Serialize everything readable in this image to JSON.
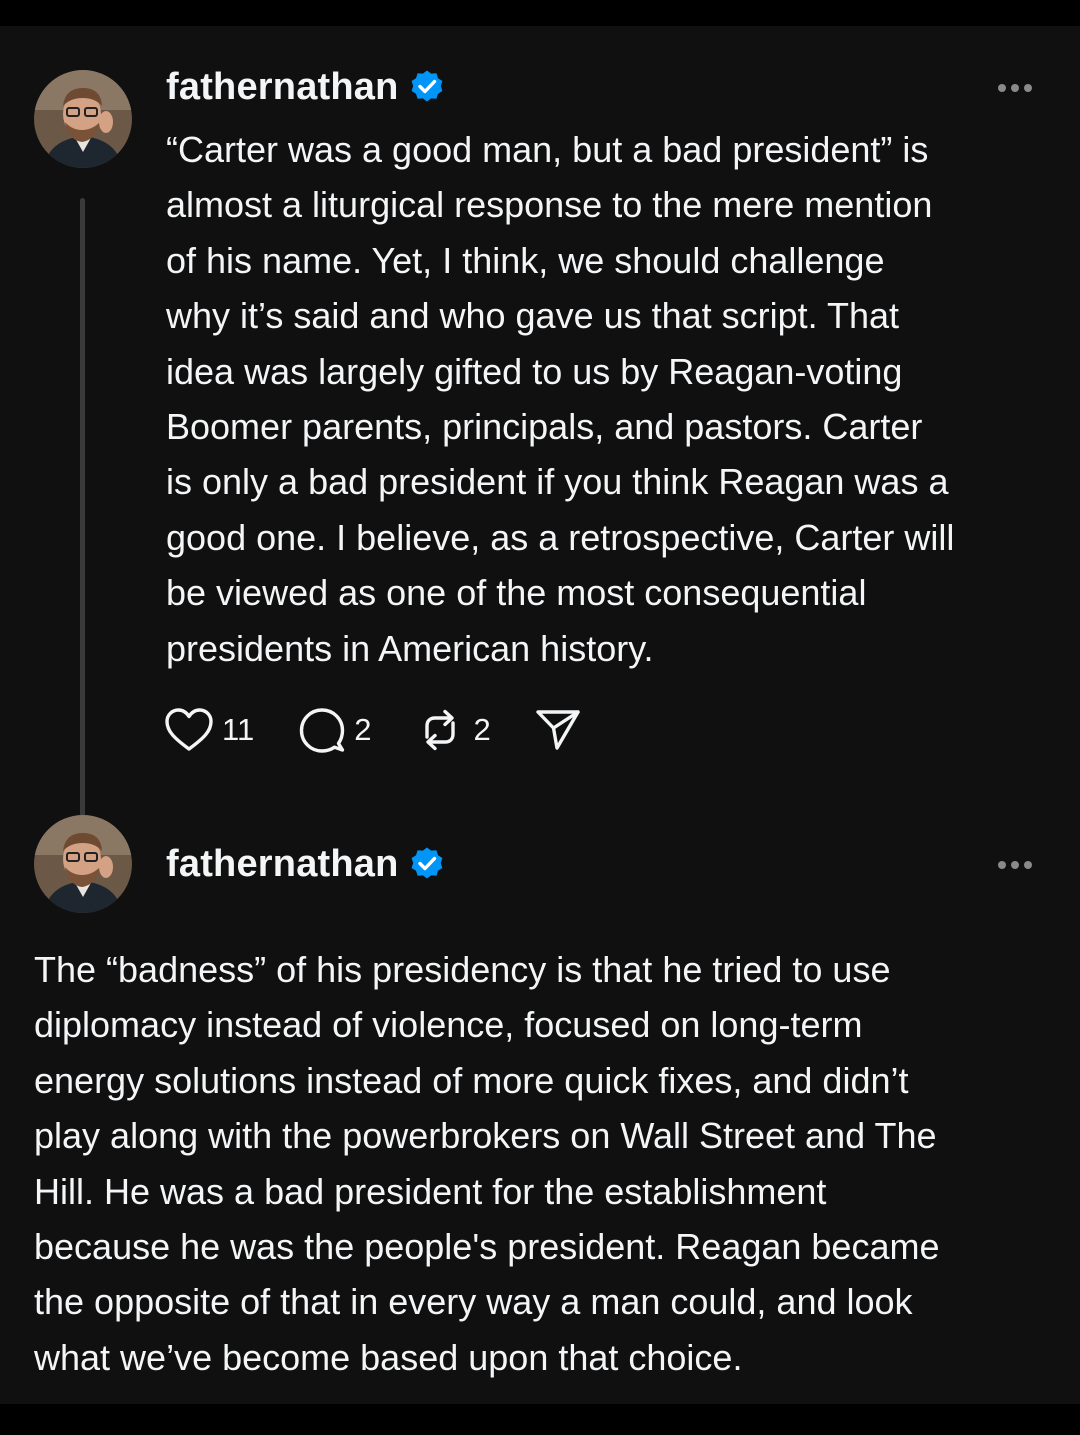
{
  "post": {
    "username": "fathernathan",
    "text": "“Carter was a good man, but a bad president” is\nalmost a liturgical response to the mere mention\nof his name. Yet, I think, we should challenge\nwhy it’s said and who gave us that script. That\nidea was largely gifted to us by Reagan-voting\nBoomer parents, principals, and pastors. Carter\nis only a bad president if you think Reagan was a\ngood one. I believe, as a retrospective, Carter will\nbe viewed as one of the most consequential\npresidents in American history.",
    "likes": "11",
    "replies": "2",
    "reposts": "2"
  },
  "reply": {
    "username": "fathernathan",
    "text": "The “badness” of his presidency is that he tried to use\ndiplomacy instead of violence, focused on long-term\nenergy solutions instead of more quick fixes, and didn’t\nplay along with the powerbrokers on Wall Street and The\nHill. He was a bad president for the establishment\nbecause he was the people's president. Reagan became\nthe opposite of that in every way a man could, and look\nwhat we’ve become based upon that choice."
  },
  "icons": {
    "verified": "verified-badge-icon",
    "more": "more-options-icon",
    "like": "heart-icon",
    "reply": "comment-icon",
    "repost": "repost-icon",
    "share": "send-icon"
  },
  "colors": {
    "background": "#101010",
    "text": "#f3f5f7",
    "verified": "#0095f6",
    "muted": "#8a8a8a"
  }
}
